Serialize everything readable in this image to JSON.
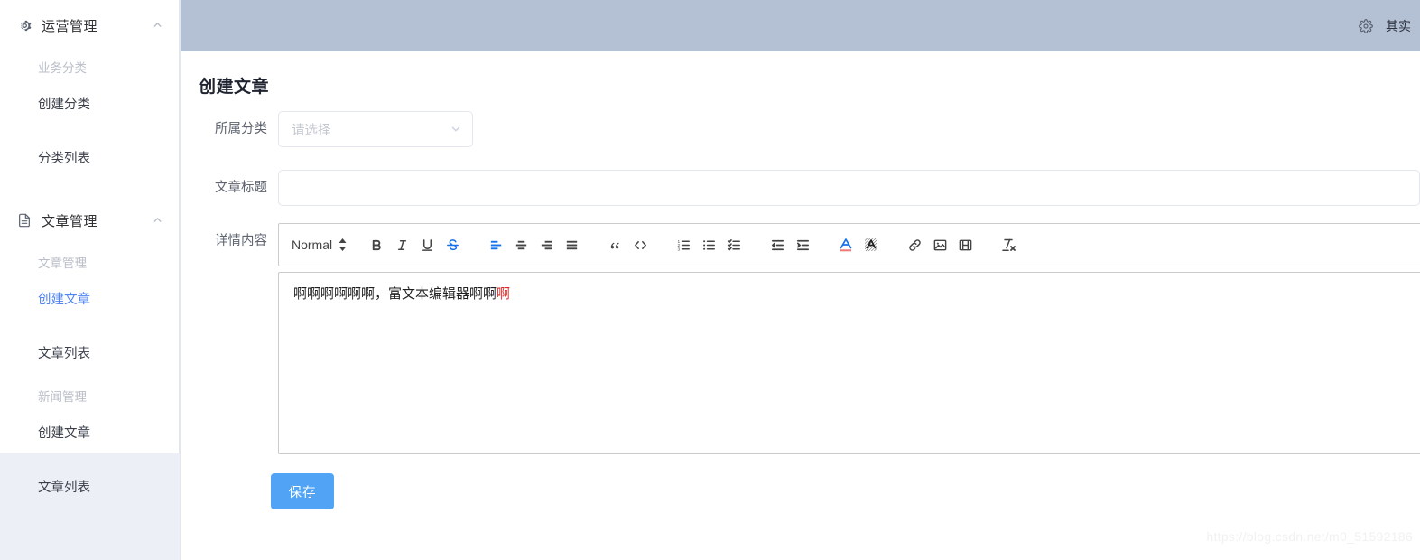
{
  "sidebar": {
    "groups": [
      {
        "icon": "gear-icon",
        "label": "运营管理",
        "arrow": "chevron-up-icon",
        "sub_title": "业务分类",
        "items": [
          {
            "label": "创建分类",
            "active": false
          },
          {
            "label": "分类列表",
            "active": false
          }
        ]
      },
      {
        "icon": "document-icon",
        "label": "文章管理",
        "arrow": "chevron-up-icon",
        "sub_title": "文章管理",
        "items": [
          {
            "label": "创建文章",
            "active": true
          },
          {
            "label": "文章列表",
            "active": false
          }
        ],
        "sub_title_2": "新闻管理",
        "items_2": [
          {
            "label": "创建文章",
            "active": false
          },
          {
            "label": "文章列表",
            "active": false
          }
        ]
      }
    ]
  },
  "header": {
    "gear_icon": "gear-icon",
    "user_name": "其实"
  },
  "main": {
    "page_title": "创建文章",
    "fields": {
      "category_label": "所属分类",
      "category_placeholder": "请选择",
      "category_value": "",
      "title_label": "文章标题",
      "title_placeholder": "",
      "title_value": "",
      "content_label": "详情内容"
    },
    "editor": {
      "format_label": "Normal",
      "toolbar_buttons": [
        {
          "name": "bold-icon",
          "label": "B",
          "active": false
        },
        {
          "name": "italic-icon",
          "label": "I",
          "active": false
        },
        {
          "name": "underline-icon",
          "label": "U",
          "active": false
        },
        {
          "name": "strike-icon",
          "label": "S",
          "active": true
        },
        {
          "name": "align-left-icon",
          "label": "Align left",
          "active": true
        },
        {
          "name": "align-center-icon",
          "label": "Align center",
          "active": false
        },
        {
          "name": "align-right-icon",
          "label": "Align right",
          "active": false
        },
        {
          "name": "align-justify-icon",
          "label": "Justify",
          "active": false
        },
        {
          "name": "blockquote-icon",
          "label": "Blockquote",
          "active": false
        },
        {
          "name": "code-block-icon",
          "label": "Code block",
          "active": false
        },
        {
          "name": "ordered-list-icon",
          "label": "Ordered list",
          "active": false
        },
        {
          "name": "bullet-list-icon",
          "label": "Bullet list",
          "active": false
        },
        {
          "name": "check-list-icon",
          "label": "Check list",
          "active": false
        },
        {
          "name": "outdent-icon",
          "label": "Outdent",
          "active": false
        },
        {
          "name": "indent-icon",
          "label": "Indent",
          "active": false
        },
        {
          "name": "text-color-icon",
          "label": "Text color",
          "active": false
        },
        {
          "name": "background-color-icon",
          "label": "Background color",
          "active": false
        },
        {
          "name": "link-icon",
          "label": "Link",
          "active": false
        },
        {
          "name": "image-icon",
          "label": "Image",
          "active": false
        },
        {
          "name": "video-icon",
          "label": "Video",
          "active": false
        },
        {
          "name": "clear-format-icon",
          "label": "Clear formatting",
          "active": false
        }
      ],
      "content": {
        "part_plain": "啊啊啊啊啊啊，",
        "part_strike": "富文本编辑器啊啊",
        "part_red": "啊"
      }
    },
    "save_label": "保存"
  },
  "watermark": "https://blog.csdn.net/m0_51592186",
  "colors": {
    "header_bar": "#b4c0d3",
    "sidebar_bg": "#eceff5",
    "accent_blue": "#5084f0",
    "save_blue": "#51a3f5",
    "toolbar_active": "#1572e8",
    "editor_red": "#e02b2b"
  }
}
